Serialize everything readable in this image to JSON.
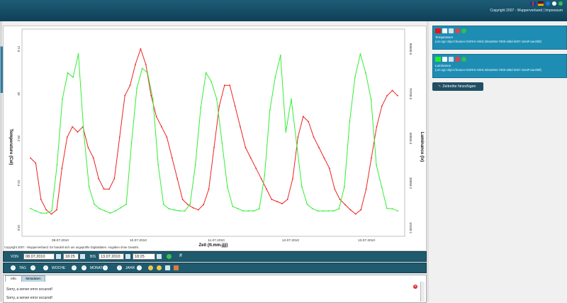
{
  "header": {
    "copyright": "Copyright 2007 - Wupperverband | Impressum",
    "icons": [
      "uk-flag-icon",
      "de-flag-icon",
      "help-icon",
      "home-icon",
      "refresh-icon"
    ]
  },
  "chart": {
    "y_left_label": "Temperature (Cel)",
    "y_right_label": "Luminance (lx)",
    "x_label": "Zeit (tt.mm.jjjj)",
    "left_ticks": [
      "27.6",
      "33",
      "28.2",
      "23.4",
      "18.6"
    ],
    "right_ticks": [
      "80600.5",
      "70700.3",
      "60550.3",
      "30050.2",
      "10100.1"
    ],
    "x_ticks": [
      "08.07.2010",
      "10.07.2010",
      "11.07.2010",
      "12.07.2010",
      "13.07.2010"
    ],
    "copyright_note": "Copyright 2007 - Wupperverband. Es handelt sich um ungeprüfte Digitaldaten. Angaben ohne Gewähr."
  },
  "chart_data": {
    "type": "line",
    "xlabel": "Zeit (tt.mm.jjjj)",
    "ylabel": "Temperature (Cel)",
    "y2label": "Luminance (lx)",
    "colors": {
      "temperature": "#ee2222",
      "luminance": "#33ee33"
    },
    "series": [
      {
        "name": "Temperature",
        "axis": "left",
        "values": [
          24,
          23.5,
          20,
          19,
          18.6,
          19,
          23,
          26,
          27,
          26.5,
          27,
          25,
          24,
          22,
          21,
          21,
          22,
          26,
          30,
          31,
          33,
          34.5,
          33,
          30,
          28,
          27,
          26,
          24,
          22,
          20,
          19.5,
          19.2,
          19,
          19.5,
          21,
          25,
          29,
          31,
          31,
          29,
          27,
          25,
          24,
          23,
          22,
          21,
          20,
          19.8,
          19.6,
          20,
          22,
          26,
          28,
          27.5,
          26,
          25,
          24,
          23,
          21,
          20,
          19.5,
          19,
          18.6,
          19,
          21,
          24,
          27,
          29,
          30,
          30.5,
          30
        ]
      },
      {
        "name": "Luminance",
        "axis": "right",
        "values": [
          10100,
          9000,
          8000,
          8000,
          9000,
          30000,
          60000,
          72000,
          70000,
          80600,
          45000,
          20000,
          12000,
          10000,
          9000,
          8000,
          9000,
          10500,
          12000,
          40000,
          65000,
          74000,
          72000,
          60000,
          30000,
          12000,
          10000,
          9500,
          9000,
          9000,
          12000,
          30000,
          56000,
          72000,
          68000,
          60000,
          40000,
          20000,
          11000,
          10000,
          9000,
          9000,
          9000,
          10000,
          25000,
          55000,
          70000,
          80000,
          45000,
          60000,
          40000,
          20000,
          12000,
          10000,
          9000,
          9000,
          9000,
          9000,
          10000,
          20000,
          50000,
          70000,
          80600,
          72000,
          60000,
          30000,
          20000,
          10100,
          10000,
          9000
        ]
      }
    ]
  },
  "toolbar1": {
    "von": "VON",
    "from_date": "08.07.2010",
    "from_time": "18:25",
    "bis": "BIS",
    "to_date": "13.07.2010",
    "to_time": "18:25",
    "hash": "#"
  },
  "toolbar2": {
    "tag": "TAG",
    "woche": "WOCHE",
    "monat": "MONAT",
    "jahr": "JAHR"
  },
  "right": {
    "series": [
      {
        "name": "Temperature",
        "id": "(urn:ogc:object:feature:OSIRIS-HWS:3d3a2584-7808-4d6d-d007-1644Fcae2b8f)",
        "color": "#ee1111"
      },
      {
        "name": "Luminance",
        "id": "(urn:ogc:object:feature:OSIRIS-HWS:3d3a2584-7808-4d6d-d007-1644Fcae2b8f)",
        "color": "#22ee22"
      }
    ],
    "add_button": "Zeitreihe hinzufügen"
  },
  "info": {
    "tabs": [
      "Info",
      "Metadaten"
    ],
    "messages": [
      "Sorry, a server error occured!",
      "Sorry, a server error occured!"
    ]
  }
}
